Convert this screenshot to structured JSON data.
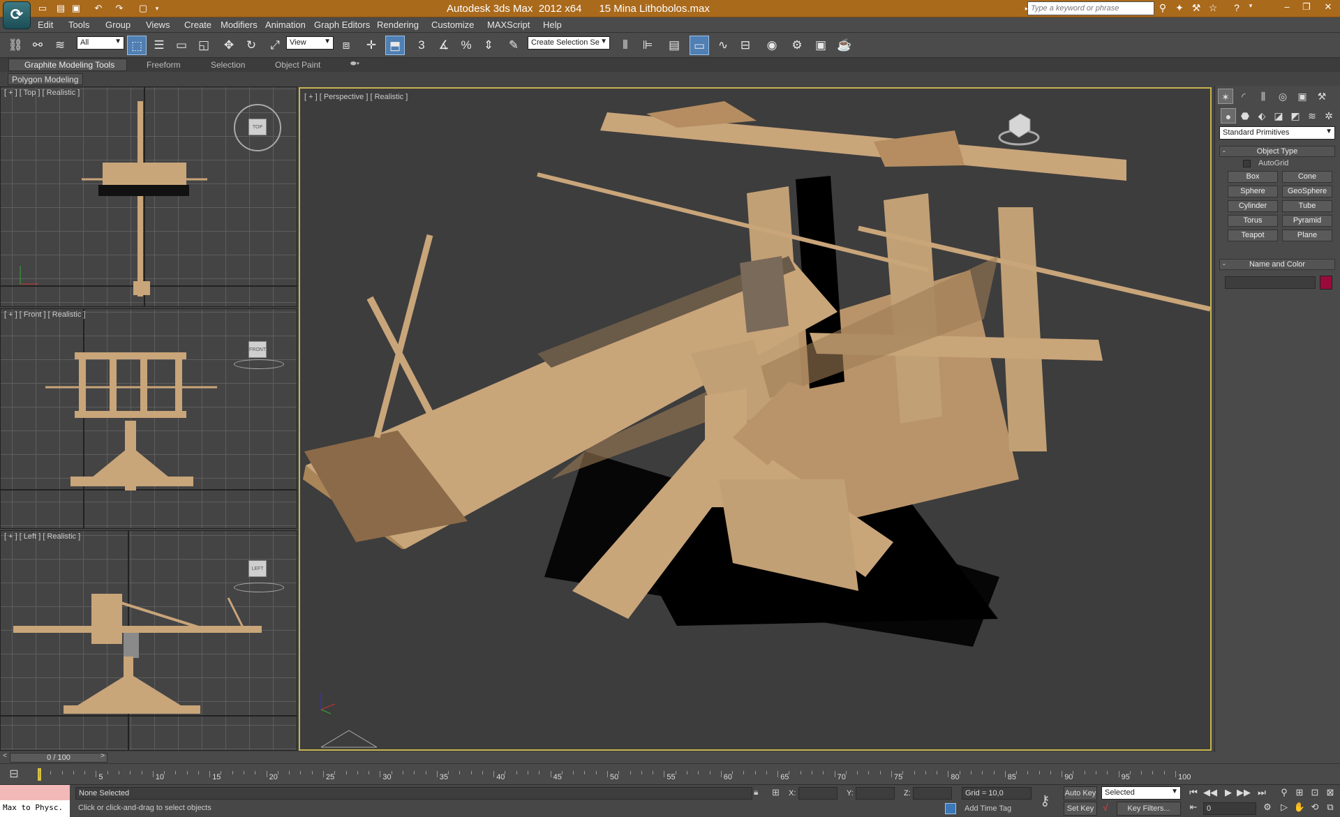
{
  "titlebar": {
    "app_title": "Autodesk 3ds Max  2012 x64      15 Mina Lithobolos.max",
    "search_placeholder": "Type a keyword or phrase",
    "logo_icon": "3ds-max-logo-icon"
  },
  "menu": [
    "Edit",
    "Tools",
    "Group",
    "Views",
    "Create",
    "Modifiers",
    "Animation",
    "Graph Editors",
    "Rendering",
    "Customize",
    "MAXScript",
    "Help"
  ],
  "toolbar": {
    "selection_filter": "All",
    "ref_coord": "View",
    "snap_label": "3",
    "named_selection": "Create Selection Se"
  },
  "ribbon": {
    "tabs": [
      "Graphite Modeling Tools",
      "Freeform",
      "Selection",
      "Object Paint"
    ],
    "sub_tab": "Polygon Modeling"
  },
  "viewports": {
    "top": {
      "label": "[ + ] [ Top ] [ Realistic ]",
      "cube": "TOP"
    },
    "front": {
      "label": "[ + ] [ Front ] [ Realistic ]",
      "cube": "FRONT"
    },
    "left": {
      "label": "[ + ] [ Left ] [ Realistic ]",
      "cube": "LEFT"
    },
    "perspective": {
      "label": "[ + ] [ Perspective ] [ Realistic ]"
    }
  },
  "command_panel": {
    "category": "Standard Primitives",
    "object_type_title": "Object Type",
    "autogrid_label": "AutoGrid",
    "buttons": [
      "Box",
      "Cone",
      "Sphere",
      "GeoSphere",
      "Cylinder",
      "Tube",
      "Torus",
      "Pyramid",
      "Teapot",
      "Plane"
    ],
    "name_color_title": "Name and Color",
    "object_color": "#9a0a3a"
  },
  "timeline": {
    "frame_counter": "0 / 100",
    "ticks": [
      "5",
      "10",
      "15",
      "20",
      "25",
      "30",
      "35",
      "40",
      "45",
      "50",
      "55",
      "60",
      "65",
      "70",
      "75",
      "80",
      "85",
      "90",
      "95",
      "100"
    ]
  },
  "status": {
    "maxscript_listener": "Max to Physc.",
    "selection_status": "None Selected",
    "prompt": "Click or click-and-drag to select objects",
    "x_label": "X:",
    "y_label": "Y:",
    "z_label": "Z:",
    "grid": "Grid = 10,0",
    "add_time_tag": "Add Time Tag",
    "auto_key": "Auto Key",
    "set_key": "Set Key",
    "key_mode": "Selected",
    "key_filters": "Key Filters...",
    "current_frame": "0"
  },
  "colors": {
    "titlebar": "#aa6a1c",
    "active_viewport_border": "#c8b44e",
    "wood": "#c9a57a"
  }
}
